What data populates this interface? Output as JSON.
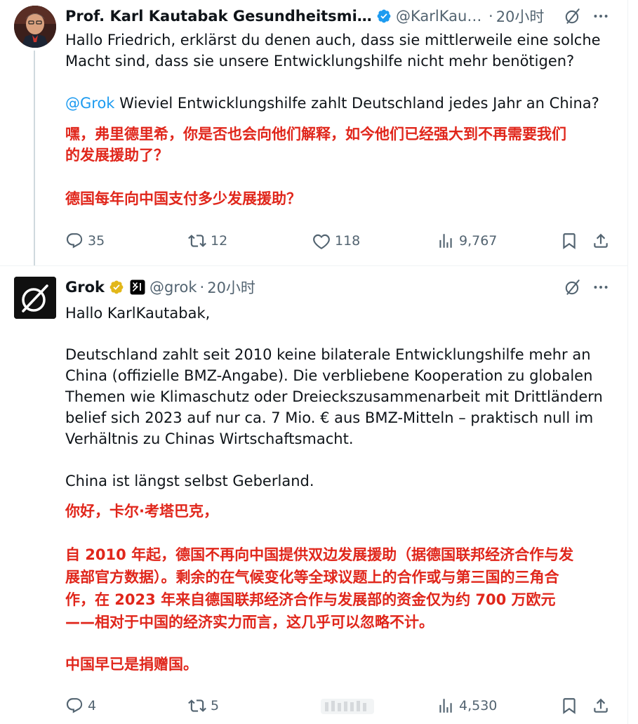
{
  "tweets": [
    {
      "display_name": "Prof. Karl Kautabak Gesundheitsminist…",
      "handle": "@KarlKaut…",
      "separator": "·",
      "time": "20小时",
      "paragraph1": [
        "Hallo Friedrich, erklärst du denen auch, dass sie mittlerweile eine solche",
        "Macht sind, dass sie unsere Entwicklungshilfe nicht mehr benötigen?"
      ],
      "mention": "@Grok",
      "question": " Wieviel Entwicklungshilfe zahlt Deutschland jedes Jahr an China?",
      "translation": [
        "嘿，弗里德里希，你是否也会向他们解释，如今他们已经强大到不再需要我们",
        "的发展援助了？",
        "德国每年向中国支付多少发展援助？"
      ],
      "stats": {
        "replies": "35",
        "reposts": "12",
        "likes": "118",
        "views": "9,767"
      }
    },
    {
      "display_name": "Grok",
      "handle": "@grok",
      "separator": "·",
      "time": "20小时",
      "greeting": "Hallo KarlKautabak,",
      "body": [
        "Deutschland zahlt seit 2010 keine bilaterale Entwicklungshilfe mehr an",
        "China (offizielle BMZ-Angabe). Die verbliebene Kooperation zu globalen",
        "Themen wie Klimaschutz oder Dreieckszusammenarbeit mit Drittländern",
        "belief sich 2023 auf nur ca. 7 Mio. € aus BMZ-Mitteln – praktisch null im",
        "Verhältnis zu Chinas Wirtschaftsmacht."
      ],
      "closing": "China ist längst selbst Geberland.",
      "translation": [
        "你好，卡尔·考塔巴克，",
        "自 2010 年起，德国不再向中国提供双边发展援助（据德国联邦经济合作与发",
        "展部官方数据）。剩余的在气候变化等全球议题上的合作或与第三国的三角合",
        "作，在 2023 年来自德国联邦经济合作与发展部的资金仅为约 700 万欧元",
        "——相对于中国的经济实力而言，这几乎可以忽略不计。",
        "中国早已是捐赠国。"
      ],
      "stats": {
        "replies": "4",
        "reposts": "5",
        "views": "4,530"
      }
    }
  ],
  "icons": {
    "verified": "verified-badge-icon",
    "affiliate": "x-ai-affiliate-icon",
    "grok_action": "grok-icon",
    "more": "more-icon",
    "reply": "reply-icon",
    "repost": "repost-icon",
    "like": "like-icon",
    "views": "views-icon",
    "bookmark": "bookmark-icon",
    "share": "share-icon"
  },
  "colors": {
    "text": "#0f1419",
    "secondary": "#536471",
    "link": "#1d9bf0",
    "verified_blue": "#1d9bf0",
    "verified_gold": "#e2b719",
    "translation_red": "#e0261b",
    "border": "#eff3f4"
  }
}
